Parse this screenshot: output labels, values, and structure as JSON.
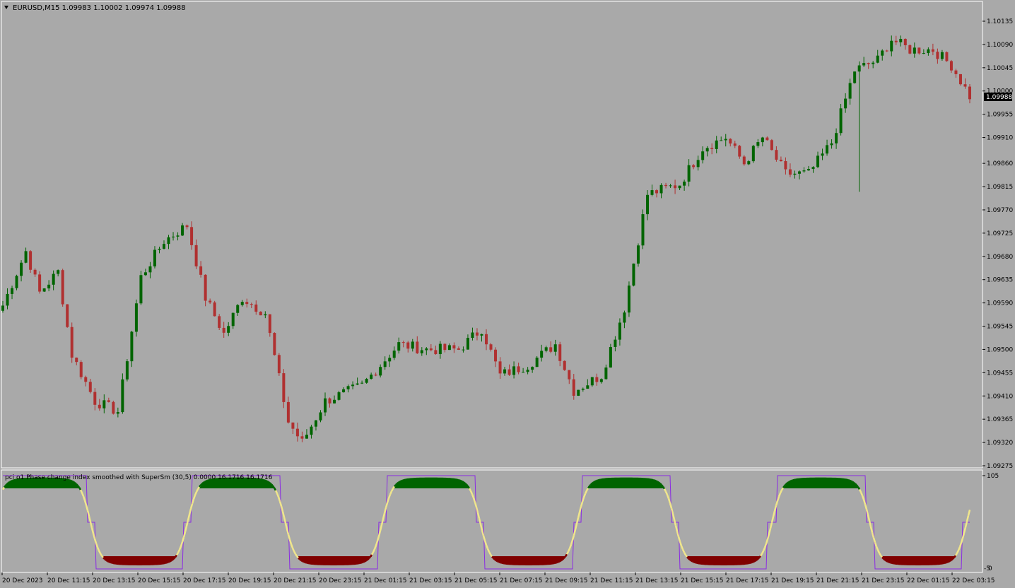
{
  "main": {
    "header": "EURUSD,M15  1.09983 1.10002 1.09974 1.09988",
    "price_labels": [
      "1.10135",
      "1.10090",
      "1.10045",
      "1.10000",
      "1.09955",
      "1.09910",
      "1.09860",
      "1.09815",
      "1.09770",
      "1.09725",
      "1.09680",
      "1.09635",
      "1.09590",
      "1.09545",
      "1.09500",
      "1.09455",
      "1.09410",
      "1.09365",
      "1.09320",
      "1.09275"
    ],
    "current_price": "1.09988"
  },
  "indicator": {
    "header": "pci o1 Phase change index smoothed with SuperSm (30,5) 0.0000 16.1716 16.1716",
    "level_labels": [
      "105",
      "-5",
      "0"
    ]
  },
  "time_labels": [
    "20 Dec 2023",
    "20 Dec 11:15",
    "20 Dec 13:15",
    "20 Dec 15:15",
    "20 Dec 17:15",
    "20 Dec 19:15",
    "20 Dec 21:15",
    "20 Dec 23:15",
    "21 Dec 01:15",
    "21 Dec 03:15",
    "21 Dec 05:15",
    "21 Dec 07:15",
    "21 Dec 09:15",
    "21 Dec 11:15",
    "21 Dec 13:15",
    "21 Dec 15:15",
    "21 Dec 17:15",
    "21 Dec 19:15",
    "21 Dec 21:15",
    "21 Dec 23:15",
    "22 Dec 01:15",
    "22 Dec 03:15"
  ],
  "colors": {
    "bull": "#006400",
    "bear": "#b03030",
    "background": "#a9a9a9",
    "level_up": "#006400",
    "level_down": "#800000",
    "transition": "#f0e68c",
    "step_line": "#8a2be2"
  },
  "chart_data": [
    {
      "type": "candlestick",
      "title": "EURUSD,M15",
      "ylim": [
        1.09275,
        1.10135
      ],
      "price_ticks": [
        1.10135,
        1.1009,
        1.10045,
        1.1,
        1.09955,
        1.0991,
        1.0986,
        1.09815,
        1.0977,
        1.09725,
        1.0968,
        1.09635,
        1.0959,
        1.09545,
        1.095,
        1.09455,
        1.0941,
        1.09365,
        1.0932,
        1.09275
      ],
      "anchors": [
        [
          0,
          1.09585
        ],
        [
          5,
          1.0969
        ],
        [
          8,
          1.0961
        ],
        [
          12,
          1.0965
        ],
        [
          15,
          1.0949
        ],
        [
          20,
          1.094
        ],
        [
          25,
          1.0938
        ],
        [
          30,
          1.0964
        ],
        [
          35,
          1.0971
        ],
        [
          40,
          1.0974
        ],
        [
          44,
          1.096
        ],
        [
          48,
          1.0953
        ],
        [
          52,
          1.096
        ],
        [
          57,
          1.0957
        ],
        [
          62,
          1.0936
        ],
        [
          65,
          1.0932
        ],
        [
          70,
          1.094
        ],
        [
          78,
          1.0943
        ],
        [
          86,
          1.0951
        ],
        [
          92,
          1.095
        ],
        [
          99,
          1.095
        ],
        [
          104,
          1.0954
        ],
        [
          108,
          1.0945
        ],
        [
          114,
          1.0947
        ],
        [
          120,
          1.0951
        ],
        [
          124,
          1.0942
        ],
        [
          130,
          1.0945
        ],
        [
          135,
          1.0958
        ],
        [
          140,
          1.098
        ],
        [
          147,
          1.0982
        ],
        [
          152,
          1.0989
        ],
        [
          157,
          1.0991
        ],
        [
          161,
          1.0986
        ],
        [
          165,
          1.0991
        ],
        [
          170,
          1.0984
        ],
        [
          175,
          1.0984
        ],
        [
          180,
          1.099
        ],
        [
          185,
          1.1004
        ],
        [
          190,
          1.1006
        ],
        [
          193,
          1.101
        ],
        [
          197,
          1.1008
        ],
        [
          202,
          1.1008
        ],
        [
          206,
          1.1005
        ],
        [
          210,
          1.0999
        ]
      ],
      "spike_low": {
        "index": 186,
        "price": 1.09805
      }
    },
    {
      "type": "area",
      "title": "pci o1 Phase change index smoothed with SuperSm (30,5)",
      "ylim": [
        -5,
        105
      ],
      "upper_level": 90,
      "lower_level": 10,
      "series": [
        {
          "name": "pci",
          "wave_period": 52,
          "phase": -10,
          "min": 0,
          "max": 102
        }
      ],
      "values": [
        0.0,
        16.1716,
        16.1716
      ]
    }
  ]
}
